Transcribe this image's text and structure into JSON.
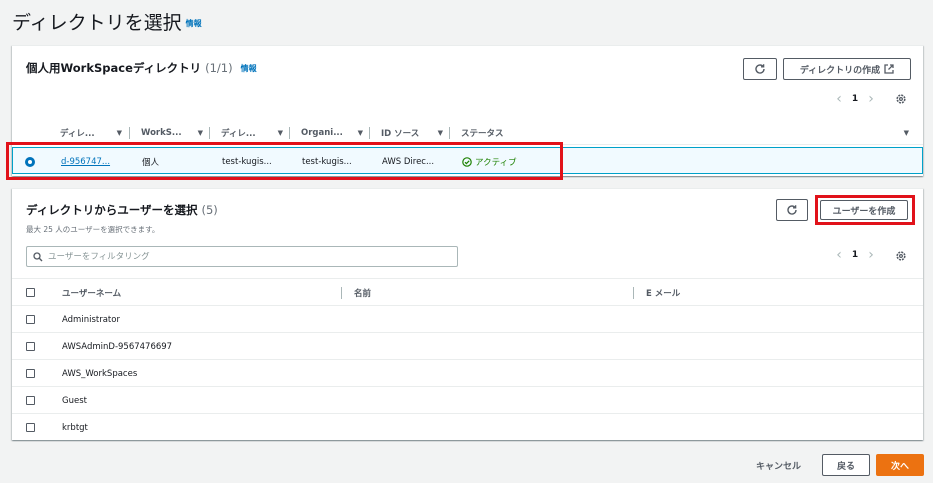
{
  "page": {
    "title": "ディレクトリを選択",
    "info": "情報"
  },
  "directories": {
    "title": "個人用WorkSpaceディレクトリ",
    "count": "(1/1)",
    "info": "情報",
    "refresh_icon": "refresh-icon",
    "create_label": "ディレクトリの作成",
    "page_number": "1",
    "columns": [
      "ディレ...",
      "WorkS...",
      "ディレ...",
      "Organi...",
      "ID ソース",
      "ステータス"
    ],
    "rows": [
      {
        "id": "d-956747...",
        "type": "個人",
        "name": "test-kugis...",
        "org": "test-kugis...",
        "source": "AWS Direc...",
        "status": "アクティブ",
        "selected": true
      }
    ]
  },
  "users": {
    "title": "ディレクトリからユーザーを選択",
    "count": "(5)",
    "description": "最大 25 人のユーザーを選択できます。",
    "create_label": "ユーザーを作成",
    "search_placeholder": "ユーザーをフィルタリング",
    "page_number": "1",
    "columns": [
      "ユーザーネーム",
      "名前",
      "E メール"
    ],
    "rows": [
      {
        "username": "Administrator"
      },
      {
        "username": "AWSAdminD-9567476697"
      },
      {
        "username": "AWS_WorkSpaces"
      },
      {
        "username": "Guest"
      },
      {
        "username": "krbtgt"
      }
    ]
  },
  "footer": {
    "cancel_label": "キャンセル",
    "back_label": "戻る",
    "next_label": "次へ"
  },
  "colors": {
    "accent": "#0073bb",
    "primary_button": "#ec7211",
    "highlight_box": "#e1121a",
    "success": "#1d8102"
  }
}
